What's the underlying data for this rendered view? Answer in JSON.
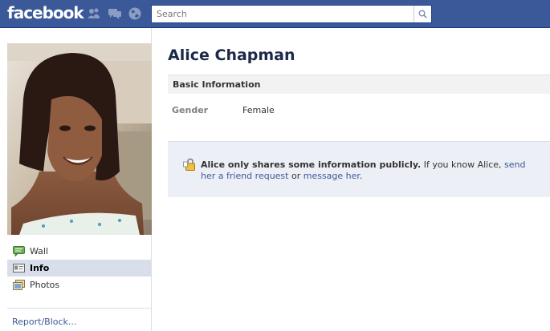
{
  "header": {
    "logo": "facebook",
    "search_placeholder": "Search"
  },
  "colors": {
    "brand_blue": "#3b5998",
    "link_blue": "#3b5998",
    "nav_selected": "#d8dfea",
    "notice_bg": "#eceff5"
  },
  "sidebar": {
    "nav_items": [
      {
        "label": "Wall",
        "icon": "wall-icon",
        "selected": false
      },
      {
        "label": "Info",
        "icon": "info-icon",
        "selected": true
      },
      {
        "label": "Photos",
        "icon": "photos-icon",
        "selected": false
      }
    ],
    "report_link": "Report/Block..."
  },
  "profile": {
    "name": "Alice Chapman"
  },
  "basic_info": {
    "header": "Basic Information",
    "rows": [
      {
        "label": "Gender",
        "value": "Female"
      }
    ]
  },
  "privacy_notice": {
    "bold": "Alice only shares some information publicly.",
    "text1": " If you know Alice, ",
    "link1": "send her a friend request",
    "text2": " or ",
    "link2": "message her",
    "text3": "."
  }
}
